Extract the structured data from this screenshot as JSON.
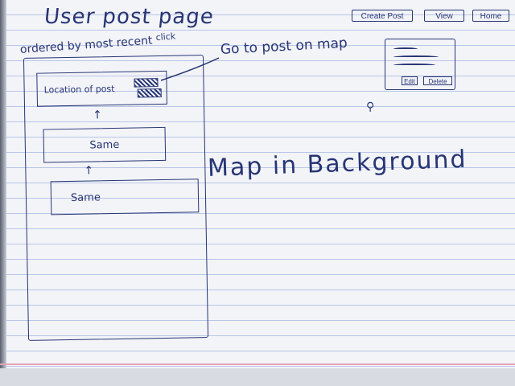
{
  "page": {
    "title": "User post page",
    "subtitle": "ordered by most recent"
  },
  "top_nav": {
    "create_post": "Create Post",
    "view": "View",
    "home": "Home"
  },
  "post_list": {
    "items": [
      {
        "label": "Location of post"
      },
      {
        "label": "Same"
      },
      {
        "label": "Same"
      }
    ],
    "arrow": "↑"
  },
  "annotations": {
    "click_note": "click",
    "go_to_post": "Go to post on map",
    "map_background": "Map in Background"
  },
  "popup": {
    "edit": "Edit",
    "delete": "Delete"
  },
  "icons": {
    "pin": "map-pin-icon"
  },
  "colors": {
    "ink": "#273574",
    "paper": "#f3f4f8",
    "rule": "#b9c6e6",
    "margin": "#e7a3b6"
  }
}
